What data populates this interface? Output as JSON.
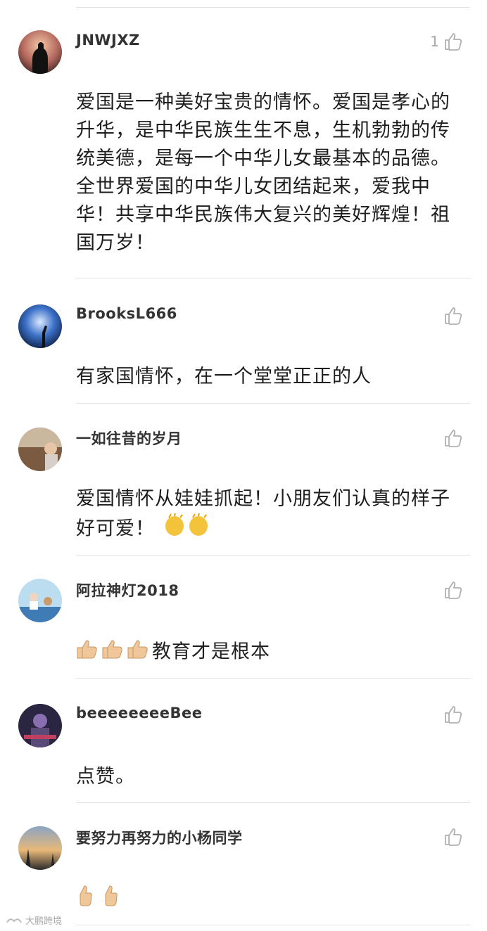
{
  "comments": [
    {
      "user": "JNWJXZ",
      "likes": "1",
      "text": "爱国是一种美好宝贵的情怀。爱国是孝心的升华，是中华民族生生不息，生机勃勃的传统美德，是每一个中华儿女最基本的品德。全世界爱国的中华儿女团结起来，爱我中华！共享中华民族伟大复兴的美好辉煌！祖国万岁！"
    },
    {
      "user": "BrooksL666",
      "likes": "",
      "text": "有家国情怀，在一个堂堂正正的人"
    },
    {
      "user": "一如往昔的岁月",
      "likes": "",
      "text": "爱国情怀从娃娃抓起！小朋友们认真的样子好可爱！"
    },
    {
      "user": "阿拉神灯2018",
      "likes": "",
      "text": "教育才是根本"
    },
    {
      "user": "beeeeeeeeBee",
      "likes": "",
      "text": "点赞。"
    },
    {
      "user": "要努力再努力的小杨同学",
      "likes": "",
      "text": ""
    }
  ],
  "watermark": "大鹏跨境"
}
